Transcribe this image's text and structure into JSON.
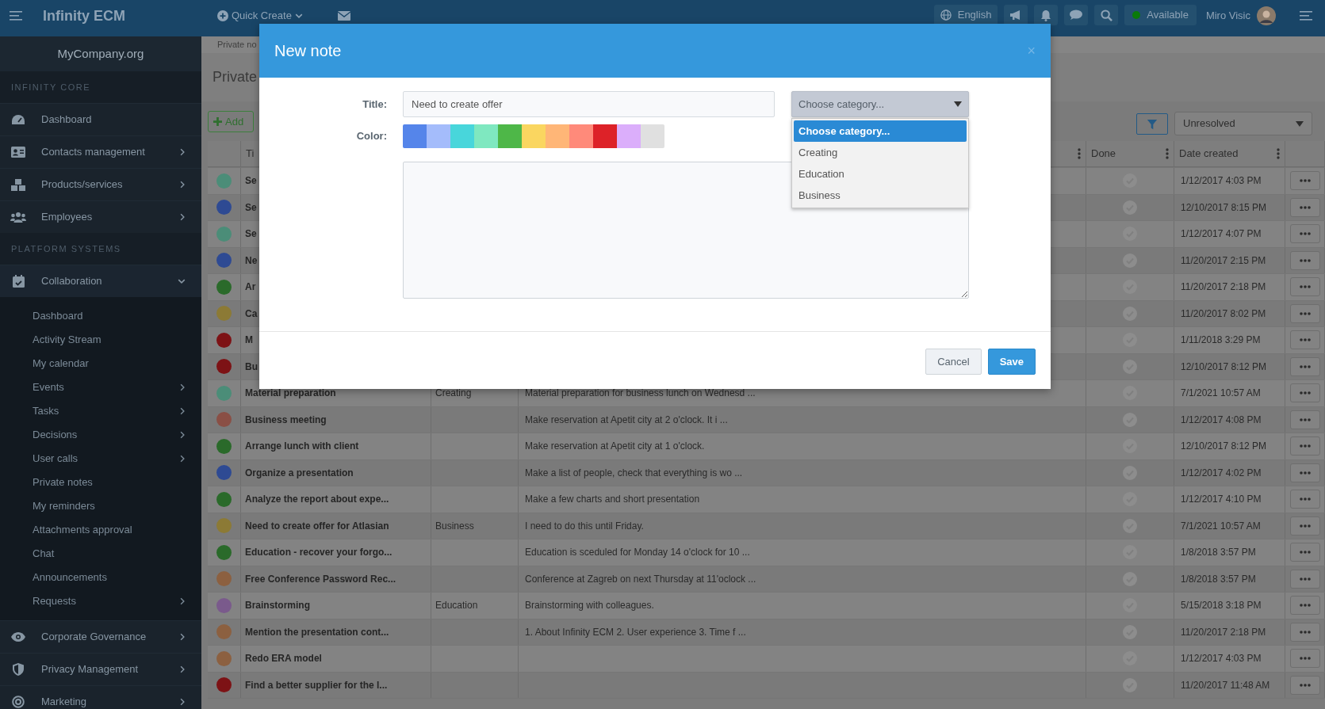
{
  "topbar": {
    "brand": "Infinity ECM",
    "quick_create": "Quick Create",
    "language": "English",
    "status": "Available",
    "user": "Miro Visic"
  },
  "sidebar": {
    "company": "MyCompany.org",
    "sections": [
      {
        "heading": "INFINITY CORE",
        "items": [
          {
            "label": "Dashboard",
            "expandable": false
          },
          {
            "label": "Contacts management",
            "expandable": true
          },
          {
            "label": "Products/services",
            "expandable": true
          },
          {
            "label": "Employees",
            "expandable": true
          }
        ]
      },
      {
        "heading": "PLATFORM SYSTEMS",
        "items": [
          {
            "label": "Collaboration",
            "expandable": true,
            "expanded": true,
            "children": [
              {
                "label": "Dashboard",
                "expandable": false
              },
              {
                "label": "Activity Stream",
                "expandable": false
              },
              {
                "label": "My calendar",
                "expandable": false
              },
              {
                "label": "Events",
                "expandable": true
              },
              {
                "label": "Tasks",
                "expandable": true
              },
              {
                "label": "Decisions",
                "expandable": true
              },
              {
                "label": "User calls",
                "expandable": true
              },
              {
                "label": "Private notes",
                "expandable": false
              },
              {
                "label": "My reminders",
                "expandable": false
              },
              {
                "label": "Attachments approval",
                "expandable": false
              },
              {
                "label": "Chat",
                "expandable": false
              },
              {
                "label": "Announcements",
                "expandable": false
              },
              {
                "label": "Requests",
                "expandable": true
              }
            ]
          },
          {
            "label": "Corporate Governance",
            "expandable": true,
            "expanded": false
          },
          {
            "label": "Privacy Management",
            "expandable": true,
            "expanded": false
          },
          {
            "label": "Marketing",
            "expandable": true,
            "expanded": false
          }
        ]
      }
    ]
  },
  "page": {
    "breadcrumb": "Private no",
    "title": "Private",
    "add_button": "Add",
    "filter_value": "Unresolved"
  },
  "table": {
    "header": {
      "title_column": "Ti",
      "done_column": "Done",
      "date_column": "Date created"
    },
    "rows": [
      {
        "color": "#4b8d78",
        "title": "Se",
        "date": "1/12/2017 4:03 PM"
      },
      {
        "color": "#2e4a93",
        "title": "Se",
        "date": "12/10/2017 8:15 PM"
      },
      {
        "color": "#4b8d78",
        "title": "Se",
        "date": "1/12/2017 4:07 PM"
      },
      {
        "color": "#2e4a93",
        "title": "Ne",
        "date": "11/20/2017 2:15 PM"
      },
      {
        "color": "#2a6a2a",
        "title": "Ar",
        "date": "11/20/2017 2:18 PM"
      },
      {
        "color": "#8c7a35",
        "title": "Ca",
        "date": "11/20/2017 8:02 PM"
      },
      {
        "color": "#7d1215",
        "title": "M",
        "date": "1/11/2018 3:29 PM"
      },
      {
        "color": "#7d1215",
        "title": "Bu",
        "date": "12/10/2017 8:12 PM"
      },
      {
        "color": "#4b8d78",
        "title": "Material preparation",
        "category": "Creating",
        "description": "Material preparation for business lunch on Wednesd ...",
        "date": "7/1/2021 10:57 AM"
      },
      {
        "color": "#8a4f45",
        "title": "Business meeting",
        "description": "Make reservation at Apetit city at 2 o'clock. It i ...",
        "date": "1/12/2017 4:08 PM"
      },
      {
        "color": "#2a6a2a",
        "title": "Arrange lunch with client",
        "description": "Make reservation at Apetit city at 1 o'clock.",
        "date": "12/10/2017 8:12 PM"
      },
      {
        "color": "#2e4a93",
        "title": "Organize a presentation",
        "description": "Make a list of people, check that everything is wo ...",
        "date": "1/12/2017 4:02 PM"
      },
      {
        "color": "#2a6a2a",
        "title": "Analyze the report about expe...",
        "description": "Make a few charts and short presentation",
        "date": "1/12/2017 4:10 PM"
      },
      {
        "color": "#8c7a35",
        "title": "Need to create offer for Atlasian",
        "category": "Business",
        "description": "I need to do this until Friday.",
        "date": "7/1/2021 10:57 AM"
      },
      {
        "color": "#2a6a2a",
        "title": "Education - recover your forgo...",
        "description": "Education is sceduled for Monday 14 o'clock for 10 ...",
        "date": "1/8/2018 3:57 PM"
      },
      {
        "color": "#8c6040",
        "title": "Free Conference Password Rec...",
        "description": "Conference at Zagreb on next Thursday at 11'oclock ...",
        "date": "1/8/2018 3:57 PM"
      },
      {
        "color": "#7a5a8c",
        "title": "Brainstorming",
        "category": "Education",
        "description": "Brainstorming with colleagues.",
        "date": "5/15/2018 3:18 PM"
      },
      {
        "color": "#8c6040",
        "title": "Mention the presentation cont...",
        "description": "1. About Infinity ECM 2. User experience 3. Time f ...",
        "date": "11/20/2017 2:18 PM"
      },
      {
        "color": "#8c6040",
        "title": "Redo ERA model",
        "date": "1/12/2017 4:03 PM"
      },
      {
        "color": "#7d1215",
        "title": "Find a better supplier for the l...",
        "date": "11/20/2017 11:48 AM"
      }
    ]
  },
  "modal": {
    "title": "New note",
    "close": "×",
    "title_label": "Title:",
    "title_value": "Need to create offer",
    "color_label": "Color:",
    "category": {
      "value": "Choose category...",
      "options": [
        {
          "label": "Choose category...",
          "selected": true
        },
        {
          "label": "Creating",
          "selected": false
        },
        {
          "label": "Education",
          "selected": false
        },
        {
          "label": "Business",
          "selected": false
        }
      ]
    },
    "colors": [
      {
        "color": "#5585ea"
      },
      {
        "color": "#a4bcfb"
      },
      {
        "color": "#48d6db"
      },
      {
        "color": "#7fe8c0"
      },
      {
        "color": "#4eb748"
      },
      {
        "color": "#fad660"
      },
      {
        "color": "#ffb677"
      },
      {
        "color": "#ff8a7a"
      },
      {
        "color": "#dd2228"
      },
      {
        "color": "#dbaefb"
      },
      {
        "color": "#e0e0e0"
      }
    ],
    "buttons": [
      {
        "label": "Cancel",
        "kind": "secondary"
      },
      {
        "label": "Save",
        "kind": "primary"
      }
    ]
  }
}
